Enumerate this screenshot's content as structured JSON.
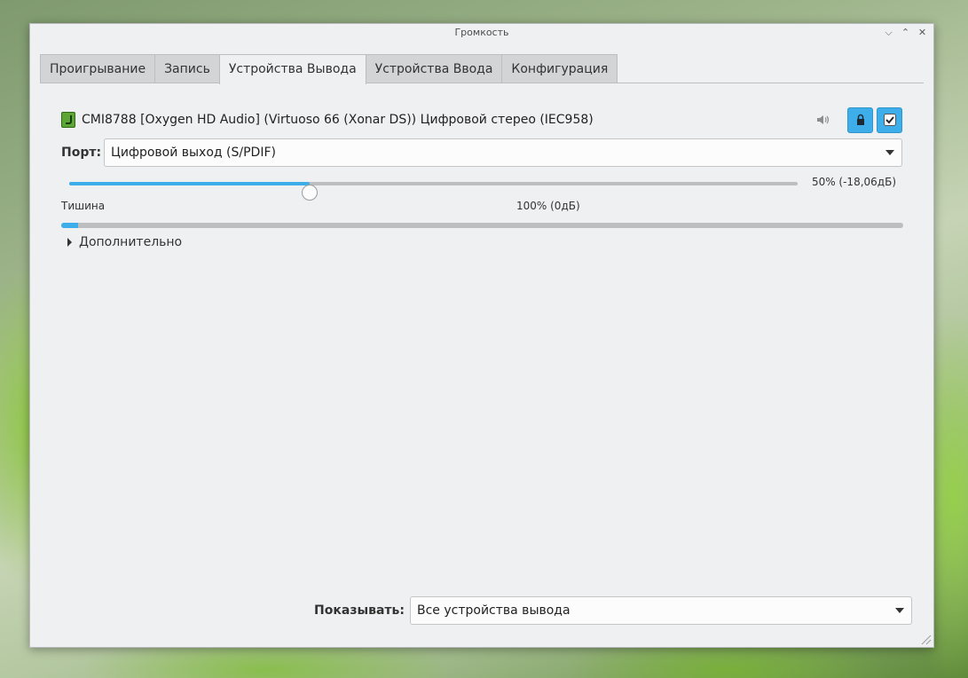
{
  "window": {
    "title": "Громкость"
  },
  "window_controls": {
    "minimize": "⌵",
    "maximize": "⌃",
    "close": "✕"
  },
  "tabs": [
    {
      "label": "Проигрывание",
      "active": false
    },
    {
      "label": "Запись",
      "active": false
    },
    {
      "label": "Устройства Вывода",
      "active": true
    },
    {
      "label": "Устройства Ввода",
      "active": false
    },
    {
      "label": "Конфигурация",
      "active": false
    }
  ],
  "device": {
    "name": "CMI8788 [Oxygen HD Audio] (Virtuoso 66 (Xonar DS)) Цифровой стерео (IEC958)",
    "icon": "audio-card-icon",
    "mute_icon": "speaker-icon",
    "lock_icon": "lock-icon",
    "default_icon": "check-icon",
    "port_label": "Порт:",
    "port_value": "Цифровой выход (S/PDIF)",
    "volume_fraction": 0.5,
    "volume_text": "50% (-18,06дБ)",
    "mark_silence": "Тишина",
    "mark_100": "100% (0дБ)",
    "peak_level": 0.02,
    "advanced_label": "Дополнительно"
  },
  "footer": {
    "show_label": "Показывать:",
    "show_value": "Все устройства вывода"
  },
  "colors": {
    "accent": "#3daee9",
    "window_bg": "#eff0f1"
  }
}
